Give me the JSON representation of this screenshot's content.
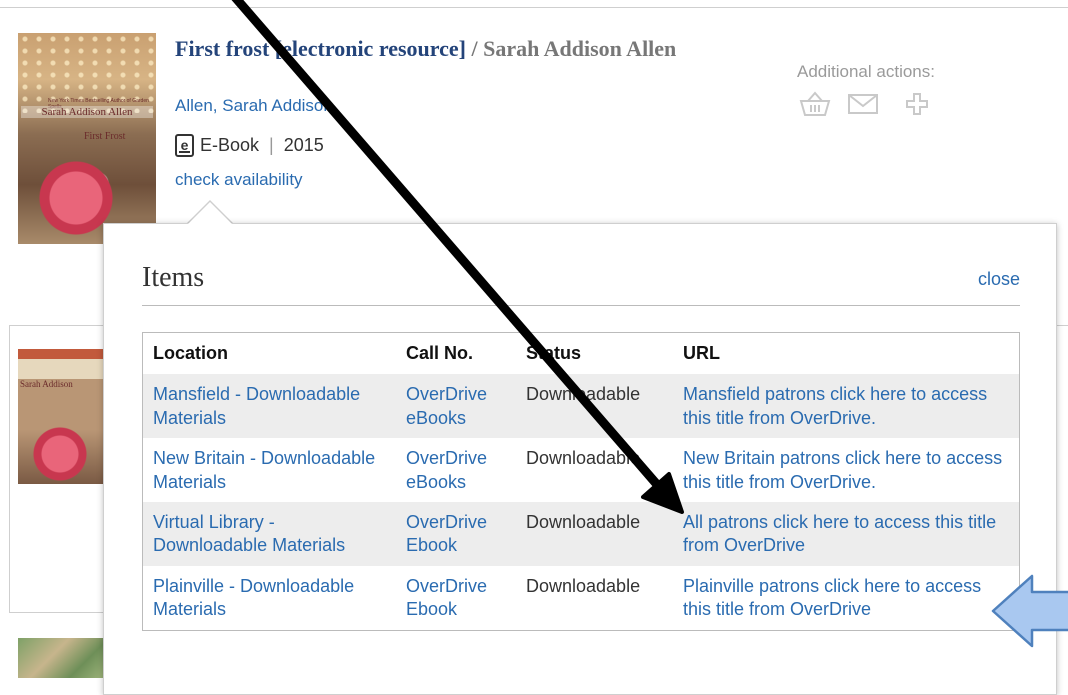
{
  "result1": {
    "cover": {
      "author_text": "Sarah Addison Allen",
      "tagline": "New York Times Bestselling Author of Garden Spells",
      "title_text": "First Frost"
    },
    "title_link": "First frost [electronic resource]",
    "title_sep": " / ",
    "title_author": "Sarah Addison Allen",
    "author_link": "Allen, Sarah Addison.",
    "format_icon": "ebook-icon",
    "format_icon_glyph": "e",
    "format": "E-Book",
    "format_sep": "|",
    "year": "2015",
    "check_availability": "check availability",
    "additional_actions": {
      "label": "Additional actions:",
      "icons": [
        "basket-icon",
        "envelope-icon",
        "plus-icon"
      ]
    }
  },
  "result2": {
    "cover_text": "Sarah Addison"
  },
  "popup": {
    "title": "Items",
    "close": "close",
    "columns": [
      "Location",
      "Call No.",
      "Status",
      "URL"
    ],
    "rows": [
      {
        "location": "Mansfield - Downloadable Materials",
        "call_no": "OverDrive eBooks",
        "status": "Downloadable",
        "url": "Mansfield patrons click here to access this title from OverDrive."
      },
      {
        "location": "New Britain - Downloadable Materials",
        "call_no": "OverDrive eBooks",
        "status": "Downloadable",
        "url": "New Britain patrons click here to access this title from OverDrive."
      },
      {
        "location": "Virtual Library - Downloadable Materials",
        "call_no": "OverDrive Ebook",
        "status": "Downloadable",
        "url": "All patrons click here to access this title from OverDrive"
      },
      {
        "location": "Plainville - Downloadable Materials",
        "call_no": "OverDrive Ebook",
        "status": "Downloadable",
        "url": "Plainville patrons click here to access this title from OverDrive"
      }
    ]
  },
  "annotations": {
    "black_arrow_color": "#000000",
    "blue_arrow_fill": "#a9c8f0",
    "blue_arrow_stroke": "#4f81bd"
  }
}
